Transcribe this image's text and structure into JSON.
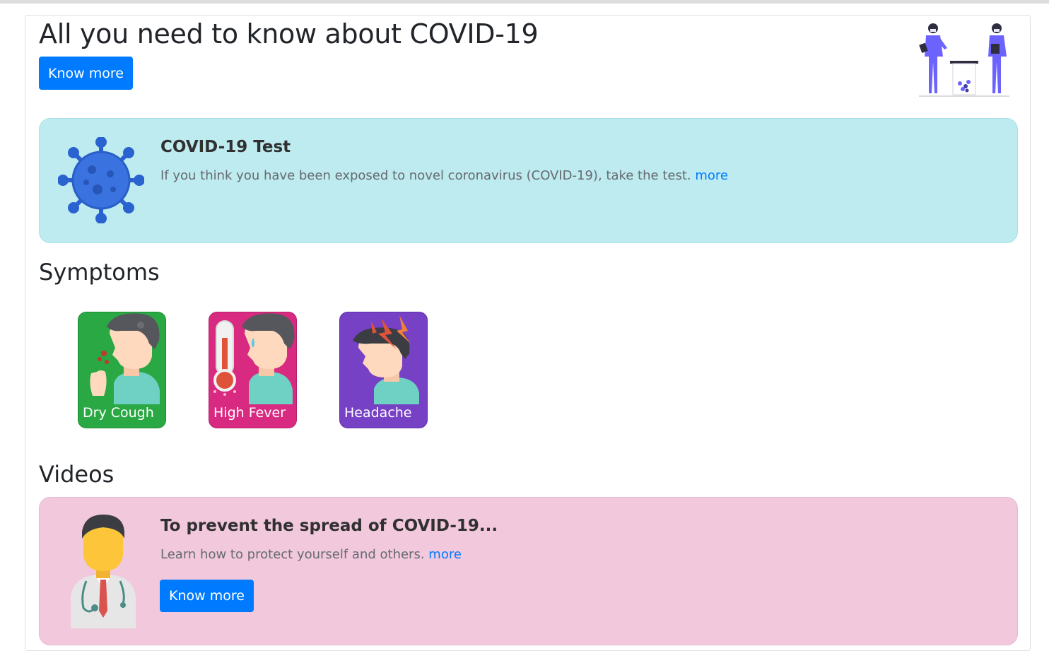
{
  "hero": {
    "title": "All you need to know about COVID-19",
    "button_label": "Know more",
    "illustration_icon": "doctors-testing-illustration-icon"
  },
  "test_card": {
    "title": "COVID-19 Test",
    "text": "If you think you have been exposed to novel coronavirus (COVID-19), take the test.",
    "link": "more",
    "icon": "virus-icon",
    "background": "#bdebef"
  },
  "symptoms": {
    "title": "Symptoms",
    "items": [
      {
        "label": "Dry Cough",
        "icon": "cough-icon",
        "color": "#2aa844"
      },
      {
        "label": "High Fever",
        "icon": "fever-thermometer-icon",
        "color": "#d82a80"
      },
      {
        "label": "Headache",
        "icon": "headache-icon",
        "color": "#7641c4"
      }
    ]
  },
  "videos": {
    "title": "Videos",
    "card": {
      "title": "To prevent the spread of COVID-19...",
      "text": "Learn how to protect yourself and others.",
      "link": "more",
      "button_label": "Know more",
      "icon": "doctor-icon",
      "background": "#f2c8dd"
    }
  },
  "colors": {
    "primary": "#007bff",
    "link": "#007bff"
  }
}
